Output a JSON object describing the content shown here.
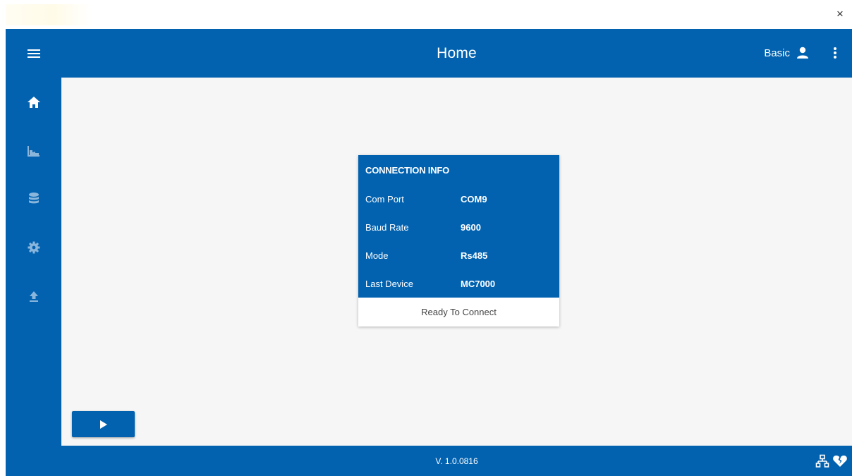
{
  "window": {
    "close_glyph": "×"
  },
  "header": {
    "title": "Home",
    "user_label": "Basic",
    "user_icon": "person-icon",
    "menu_icon": "kebab-menu-icon"
  },
  "sidebar": {
    "menu_icon": "hamburger-icon",
    "items": [
      {
        "name": "home",
        "icon": "home-icon",
        "active": true
      },
      {
        "name": "charts",
        "icon": "area-chart-icon",
        "active": false
      },
      {
        "name": "database",
        "icon": "database-icon",
        "active": false
      },
      {
        "name": "settings",
        "icon": "gear-icon",
        "active": false
      },
      {
        "name": "upload",
        "icon": "upload-icon",
        "active": false
      }
    ]
  },
  "connection_card": {
    "title": "CONNECTION INFO",
    "rows": [
      {
        "label": "Com Port",
        "value": "COM9"
      },
      {
        "label": "Baud Rate",
        "value": "9600"
      },
      {
        "label": "Mode",
        "value": "Rs485"
      },
      {
        "label": "Last Device",
        "value": "MC7000"
      }
    ],
    "status": "Ready To Connect"
  },
  "play_button": {
    "icon": "play-icon"
  },
  "footer": {
    "version": "V. 1.0.0816",
    "icons": [
      "network-icon",
      "broken-heart-icon"
    ]
  },
  "colors": {
    "primary": "#0262b0",
    "content_bg": "#f6f6f6",
    "text_on_primary": "#ffffff",
    "inactive_icon": "#8ab6dc"
  }
}
